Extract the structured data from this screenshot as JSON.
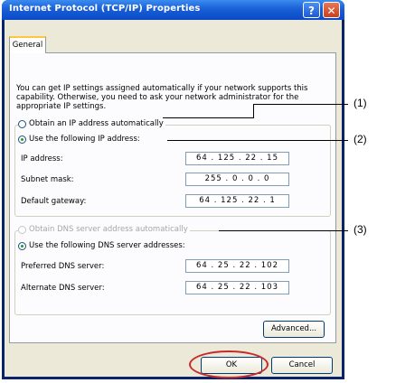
{
  "window": {
    "title": "Internet Protocol (TCP/IP) Properties",
    "help_glyph": "?",
    "close_glyph": "✕"
  },
  "tabs": [
    {
      "label": "General",
      "active": true
    }
  ],
  "intro_text": "You can get IP settings assigned automatically if your network supports this capability. Otherwise, you need to ask your network administrator for the appropriate IP settings.",
  "ip_options": {
    "auto_label": "Obtain an IP address automatically",
    "auto_selected": false,
    "manual_label": "Use the following IP address:",
    "manual_selected": true
  },
  "ip_fields": [
    {
      "label": "IP address:",
      "value": "64 . 125 . 22 . 15"
    },
    {
      "label": "Subnet mask:",
      "value": "255 . 0 . 0 . 0"
    },
    {
      "label": "Default gateway:",
      "value": "64 . 125 . 22 . 1"
    }
  ],
  "dns_options": {
    "auto_label": "Obtain DNS server address automatically",
    "auto_enabled": false,
    "manual_label": "Use the following DNS server addresses:",
    "manual_selected": true
  },
  "dns_fields": [
    {
      "label": "Preferred DNS server:",
      "value": "64 . 25 . 22 . 102"
    },
    {
      "label": "Alternate DNS server:",
      "value": "64 . 25 . 22 . 103"
    }
  ],
  "buttons": {
    "advanced": "Advanced...",
    "ok": "OK",
    "cancel": "Cancel"
  },
  "callouts": [
    "(1)",
    "(2)",
    "(3)"
  ],
  "colors": {
    "titlebar": "#0a49c6",
    "highlight_ring": "#c62a2a",
    "radio_dot": "#20a020"
  }
}
